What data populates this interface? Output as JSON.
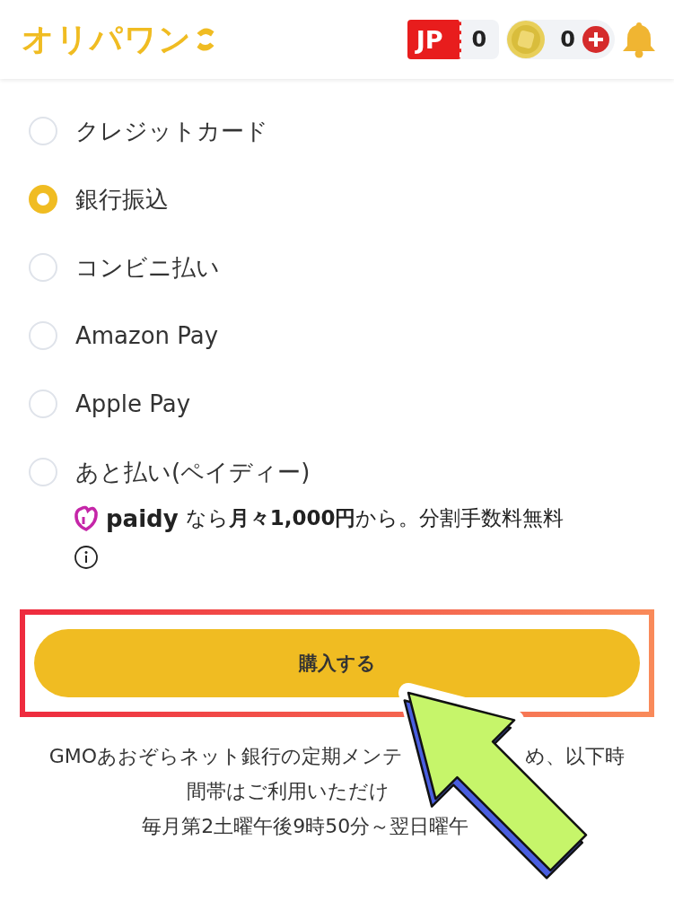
{
  "header": {
    "logo": "オリパワン",
    "ticket_label": "JP",
    "ticket_count": "0",
    "coin_count": "0"
  },
  "payment_methods": [
    {
      "label": "クレジットカード",
      "selected": false
    },
    {
      "label": "銀行振込",
      "selected": true
    },
    {
      "label": "コンビニ払い",
      "selected": false
    },
    {
      "label": "Amazon Pay",
      "selected": false
    },
    {
      "label": "Apple Pay",
      "selected": false
    },
    {
      "label": "あと払い(ペイディー)",
      "selected": false
    }
  ],
  "paidy_note": {
    "brand": "paidy",
    "text": "なら**月々1,000円**から。分割手数料無料"
  },
  "purchase_button": "購入する",
  "notice_lines": [
    {
      "before_arrow": "GMOあおぞらネット銀行の定期メンテ",
      "after_arrow": "め、以下時"
    },
    {
      "before_arrow": "間帯はご利用いただけ"
    },
    {
      "before_arrow": "毎月第2土曜午後9時50分～翌日曜午"
    }
  ]
}
